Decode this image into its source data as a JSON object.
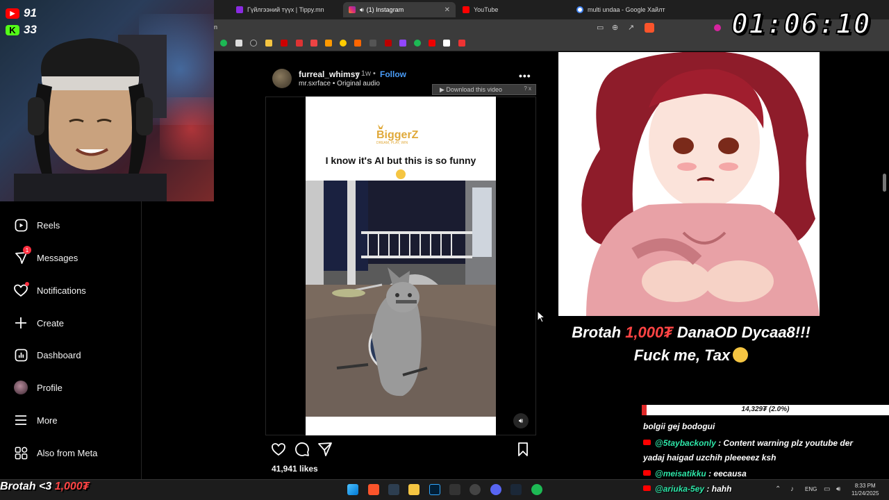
{
  "browser": {
    "tabs": [
      {
        "label": "Гүйлгээний түүх | Tippy.mn",
        "color": "#8a2be2",
        "active": false
      },
      {
        "label": "(1) Instagram",
        "color": "#e1306c",
        "active": true
      },
      {
        "label": "YouTube",
        "color": "#ff0000",
        "active": false
      },
      {
        "label": "multi undaa - Google Хайлт",
        "color": "#4285f4",
        "active": false
      }
    ],
    "address_text": "n",
    "new_tab": "+"
  },
  "webcam": {
    "stat_youtube": "91",
    "stat_kick": "33"
  },
  "sidebar": {
    "items": [
      {
        "label": "Reels",
        "icon": "reels-icon"
      },
      {
        "label": "Messages",
        "icon": "messages-icon",
        "badge": "1"
      },
      {
        "label": "Notifications",
        "icon": "heart-icon"
      },
      {
        "label": "Create",
        "icon": "plus-icon"
      },
      {
        "label": "Dashboard",
        "icon": "dashboard-icon"
      },
      {
        "label": "Profile",
        "icon": "avatar"
      },
      {
        "label": "More",
        "icon": "menu-icon"
      },
      {
        "label": "Also from Meta",
        "icon": "meta-apps-icon"
      }
    ]
  },
  "post": {
    "username": "furreal_whimsy",
    "time": "• 1w •",
    "follow": "Follow",
    "audio": "mr.sxrface • Original audio",
    "more": "•••",
    "download_label": "▶ Download this video",
    "download_extra": "? x",
    "brand": "BiggerZ",
    "brand_tagline": "DREAM, PLAY, WIN",
    "caption": "I know it's AI but this is so funny",
    "likes": "41,941 likes"
  },
  "overlay": {
    "timer": "01:06:10",
    "alert_prefix": "Brotah ",
    "alert_amount": "1,000₮",
    "alert_suffix": " DanaOD Dycaa8!!!",
    "alert_line2": "Fuck me, Tax",
    "goal_text": "14,329₮ (2.0%)",
    "goal_fraction": 0.02,
    "tip_prefix": "Brotah <3 ",
    "tip_amount": "1,000₮",
    "chat": [
      {
        "user": "",
        "text": "bolgii gej bodogui",
        "yt": false
      },
      {
        "user": "@5taybackonly",
        "text": " : Content warning plz youtube der",
        "yt": true
      },
      {
        "user": "",
        "text": "yadaj haigad uzchih pleeeeez ksh",
        "yt": false
      },
      {
        "user": "@meisatikku",
        "text": " : eecausa",
        "yt": true
      },
      {
        "user": "@ariuka-5ey",
        "text": " : hahh",
        "yt": true
      }
    ]
  },
  "taskbar": {
    "lang": "ENG",
    "time": "8:33 PM",
    "date": "11/24/2025"
  },
  "colors": {
    "accent_follow": "#4a9df8",
    "alert_red": "#ff4444",
    "chat_user": "#2ee6a8"
  }
}
